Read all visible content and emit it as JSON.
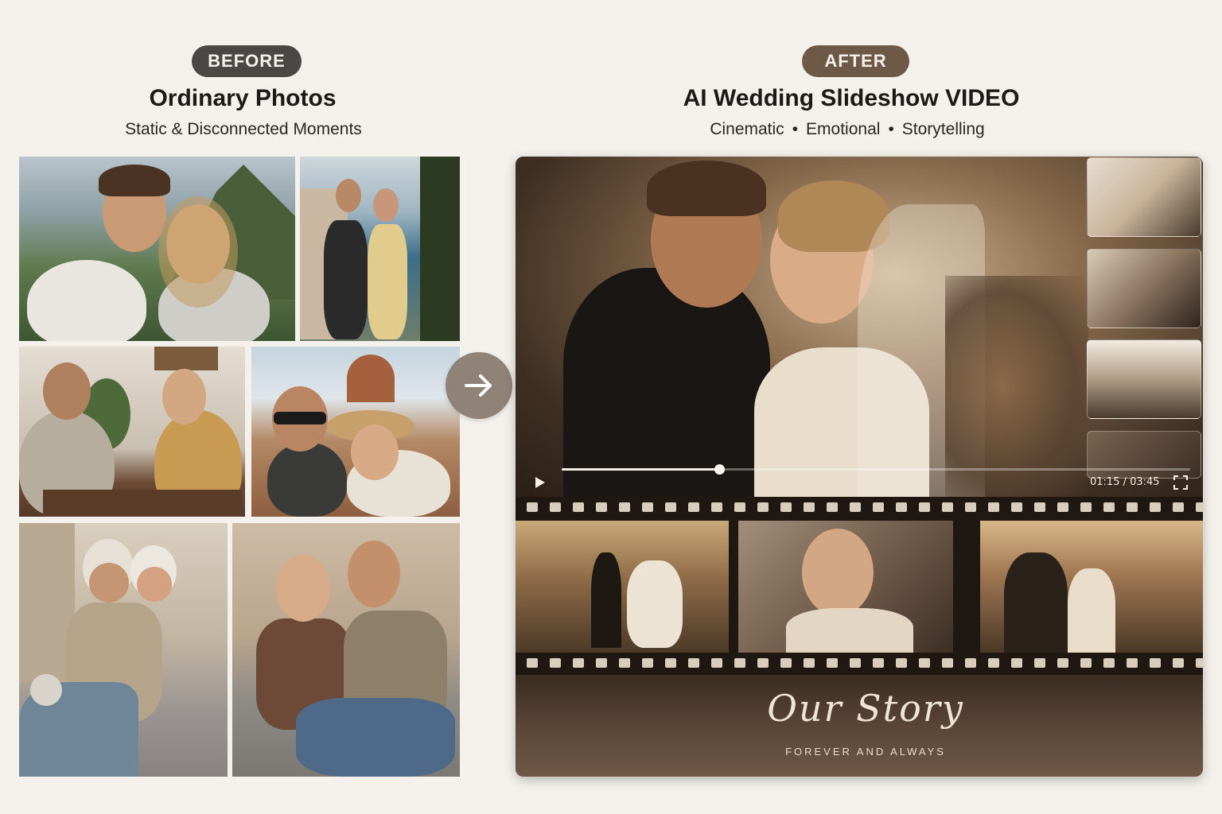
{
  "before": {
    "badge": "BEFORE",
    "title": "Ordinary Photos",
    "subtitle": "Static & Disconnected Moments"
  },
  "after": {
    "badge": "AFTER",
    "title": "AI  Wedding Slideshow VIDEO",
    "subtitle_parts": [
      "Cinematic",
      "Emotional",
      "Storytelling"
    ],
    "separator": "•"
  },
  "player": {
    "time": "01:15 / 03:45",
    "progress_fraction": 0.25,
    "play_icon": "play-icon",
    "fullscreen_icon": "fullscreen-icon"
  },
  "overlay": {
    "script_title": "Our Story",
    "tagline": "FOREVER AND ALWAYS"
  },
  "colors": {
    "background": "#f4f0eb",
    "before_badge": "#4a4744",
    "after_badge": "#6e5846",
    "arrow": "#8f8377"
  }
}
